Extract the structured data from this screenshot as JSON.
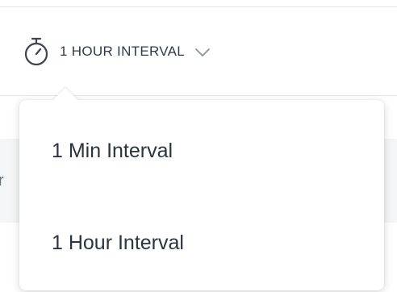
{
  "interval_selector": {
    "current_label": "1 HOUR INTERVAL",
    "icon": "stopwatch-icon",
    "chevron": "chevron-down-icon"
  },
  "background": {
    "partial_text": "r"
  },
  "dropdown": {
    "items": [
      {
        "label": "1 Min Interval"
      },
      {
        "label": "1 Hour Interval"
      }
    ]
  },
  "colors": {
    "text_primary": "#2b3440",
    "icon_stroke": "#3a4452",
    "divider": "#e3e5e8",
    "background_strip": "#f4f5f6"
  }
}
